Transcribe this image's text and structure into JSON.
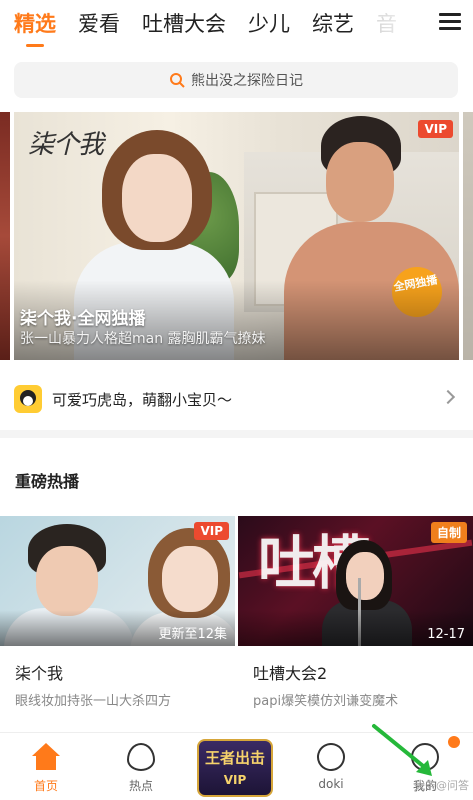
{
  "tabs": {
    "items": [
      "精选",
      "爱看",
      "吐槽大会",
      "少儿",
      "综艺",
      "音"
    ],
    "active_index": 0
  },
  "search": {
    "placeholder": "熊出没之探险日记"
  },
  "banner": {
    "logo_text": "柒个我",
    "vip": "VIP",
    "exclusive_badge": "全网独播",
    "title": "柒个我·全网独播",
    "subtitle": "张一山暴力人格超man 露胸肌霸气撩妹"
  },
  "promo": {
    "text": "可爱巧虎岛，萌翻小宝贝～"
  },
  "section": {
    "title": "重磅热播"
  },
  "cards": [
    {
      "tag": "VIP",
      "update": "更新至12集",
      "title": "柒个我",
      "desc": "眼线妆加持张一山大杀四方"
    },
    {
      "tag": "自制",
      "update": "12-17",
      "title": "吐槽大会2",
      "desc": "papi爆笑模仿刘谦变魔术",
      "poster_text": "吐槽"
    }
  ],
  "nav": {
    "items": [
      {
        "label": "首页",
        "icon": "home-icon"
      },
      {
        "label": "热点",
        "icon": "flame-icon"
      },
      {
        "label": "",
        "icon": "game-banner"
      },
      {
        "label": "doki",
        "icon": "heart-icon"
      },
      {
        "label": "我的",
        "icon": "profile-icon"
      }
    ],
    "center_text": "王者出击",
    "center_vip": "VIP"
  },
  "watermark": "头条@问答",
  "colors": {
    "accent": "#ff7a1a",
    "vip": "#ec4a2f"
  }
}
